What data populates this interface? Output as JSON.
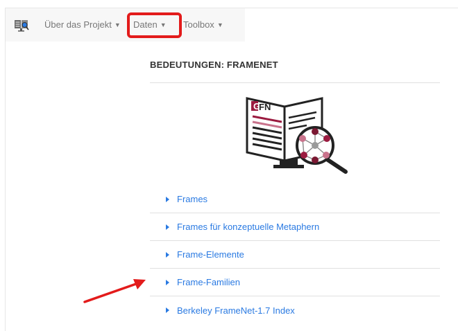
{
  "nav": {
    "about_label": "Über das Projekt",
    "data_label": "Daten",
    "toolbox_label": "Toolbox"
  },
  "section": {
    "title": "BEDEUTUNGEN: FRAMENET"
  },
  "logo": {
    "text_g": "G",
    "text_fn": "FN"
  },
  "links": [
    {
      "label": "Frames"
    },
    {
      "label": "Frames für konzeptuelle Metaphern"
    },
    {
      "label": "Frame-Elemente"
    },
    {
      "label": "Frame-Familien"
    },
    {
      "label": "Berkeley FrameNet-1.7 Index"
    }
  ],
  "colors": {
    "link": "#2a7ae2",
    "highlight": "#e31b1b",
    "brand": "#8b1a3a"
  },
  "icons": {
    "site_logo": "book-monitor-icon",
    "caret": "caret-down-icon",
    "list_bullet": "caret-right-icon"
  }
}
